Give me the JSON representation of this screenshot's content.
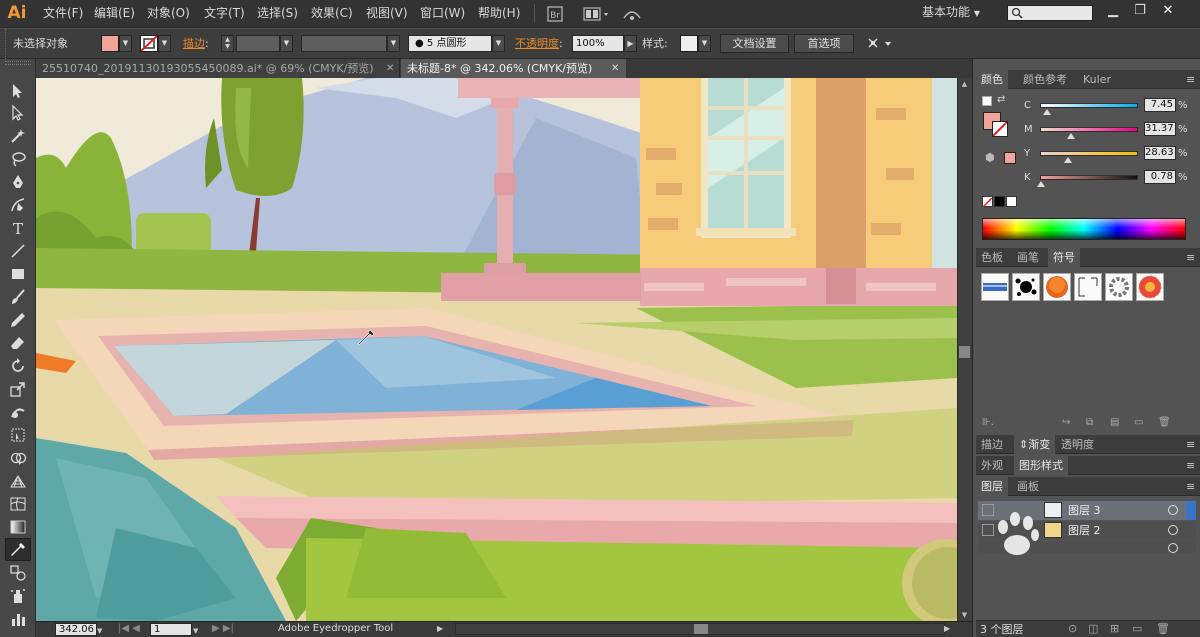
{
  "app": {
    "logo": "Ai"
  },
  "menu": [
    "文件(F)",
    "编辑(E)",
    "对象(O)",
    "文字(T)",
    "选择(S)",
    "效果(C)",
    "视图(V)",
    "窗口(W)",
    "帮助(H)"
  ],
  "workspace": {
    "label": "基本功能"
  },
  "control_bar": {
    "selection_status": "未选择对象",
    "stroke_label": "描边",
    "brush_label": "5 点圆形",
    "opacity_label": "不透明度",
    "opacity_value": "100%",
    "style_label": "样式",
    "doc_setup": "文档设置",
    "prefs": "首选项",
    "fill_color": "#f0a49a"
  },
  "tabs": [
    {
      "label": "25510740_20191130193055450089.ai* @ 69% (CMYK/预览)",
      "active": false
    },
    {
      "label": "未标题-8* @ 342.06% (CMYK/预览)",
      "active": true
    }
  ],
  "color_panel": {
    "tabs": [
      "颜色",
      "颜色参考",
      "Kuler"
    ],
    "sliders": [
      {
        "label": "C",
        "value": "7.45",
        "pct": 0.0745
      },
      {
        "label": "M",
        "value": "31.37",
        "pct": 0.3137
      },
      {
        "label": "Y",
        "value": "28.63",
        "pct": 0.2863
      },
      {
        "label": "K",
        "value": "0.78",
        "pct": 0.0078
      }
    ],
    "percent_sign": "%",
    "fill_color": "#f0a49a"
  },
  "symbols_panel": {
    "tabs": [
      "色板",
      "画笔",
      "符号"
    ]
  },
  "appearance_panel": {
    "tabs": [
      "描边",
      "渐变",
      "透明度"
    ]
  },
  "style_panel": {
    "tabs": [
      "外观",
      "图形样式"
    ]
  },
  "layers_panel": {
    "tabs": [
      "图层",
      "画板"
    ],
    "layers": [
      {
        "name": "图层 3",
        "selected": true
      },
      {
        "name": "图层 2",
        "selected": false
      }
    ],
    "count": "3 个图层"
  },
  "status_bar": {
    "zoom": "342.06",
    "artboard": "1",
    "tool": "Adobe Eyedropper Tool"
  },
  "icons": {
    "toolbar": [
      "selection-tool-icon",
      "direct-selection-tool-icon",
      "magic-wand-tool-icon",
      "lasso-tool-icon",
      "pen-tool-icon",
      "curvature-tool-icon",
      "type-tool-icon",
      "line-tool-icon",
      "rectangle-tool-icon",
      "paintbrush-tool-icon",
      "pencil-tool-icon",
      "eraser-tool-icon",
      "rotate-tool-icon",
      "scale-tool-icon",
      "warp-tool-icon",
      "free-transform-tool-icon",
      "shape-builder-tool-icon",
      "perspective-grid-tool-icon",
      "mesh-tool-icon",
      "gradient-tool-icon",
      "eyedropper-tool-icon",
      "blend-tool-icon",
      "symbol-sprayer-tool-icon",
      "column-graph-tool-icon"
    ]
  }
}
